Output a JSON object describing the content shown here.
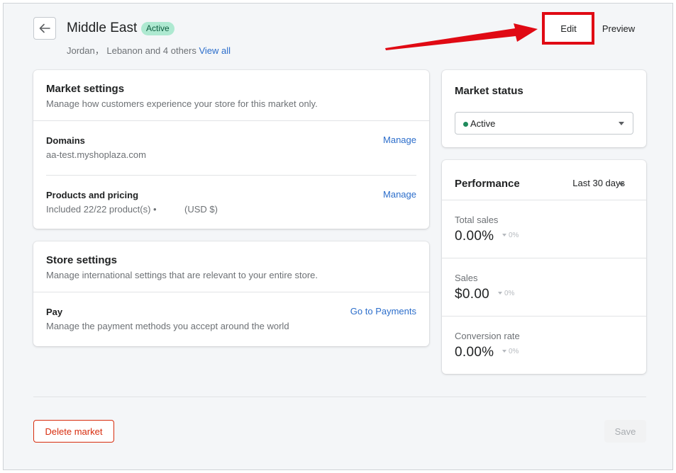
{
  "header": {
    "title": "Middle East",
    "status_badge": "Active",
    "regions_text": "Jordan， Lebanon and 4 others",
    "view_all_link": "View all",
    "edit_label": "Edit",
    "preview_label": "Preview"
  },
  "market_settings": {
    "title": "Market settings",
    "description": "Manage how customers experience your store for this market only.",
    "domains": {
      "title": "Domains",
      "value": "aa-test.myshoplaza.com",
      "action": "Manage"
    },
    "products_pricing": {
      "title": "Products and pricing",
      "value": "Included 22/22 product(s) •",
      "currency": "(USD $)",
      "action": "Manage"
    }
  },
  "store_settings": {
    "title": "Store settings",
    "description": "Manage international settings that are relevant to your entire store.",
    "pay": {
      "title": "Pay",
      "description": "Manage the payment methods you accept around the world",
      "action": "Go to Payments"
    }
  },
  "market_status": {
    "title": "Market status",
    "selected": "Active",
    "status_color": "#1f8a5c"
  },
  "performance": {
    "title": "Performance",
    "range": "Last 30 days",
    "metrics": [
      {
        "label": "Total sales",
        "value": "0.00%",
        "change": "0%"
      },
      {
        "label": "Sales",
        "value": "$0.00",
        "change": "0%"
      },
      {
        "label": "Conversion rate",
        "value": "0.00%",
        "change": "0%"
      }
    ]
  },
  "footer": {
    "delete_label": "Delete market",
    "save_label": "Save"
  },
  "colors": {
    "accent_link": "#2c6ecb",
    "annotation_red": "#e00a14",
    "critical": "#d72c0d",
    "badge_bg": "#aee9d1"
  }
}
